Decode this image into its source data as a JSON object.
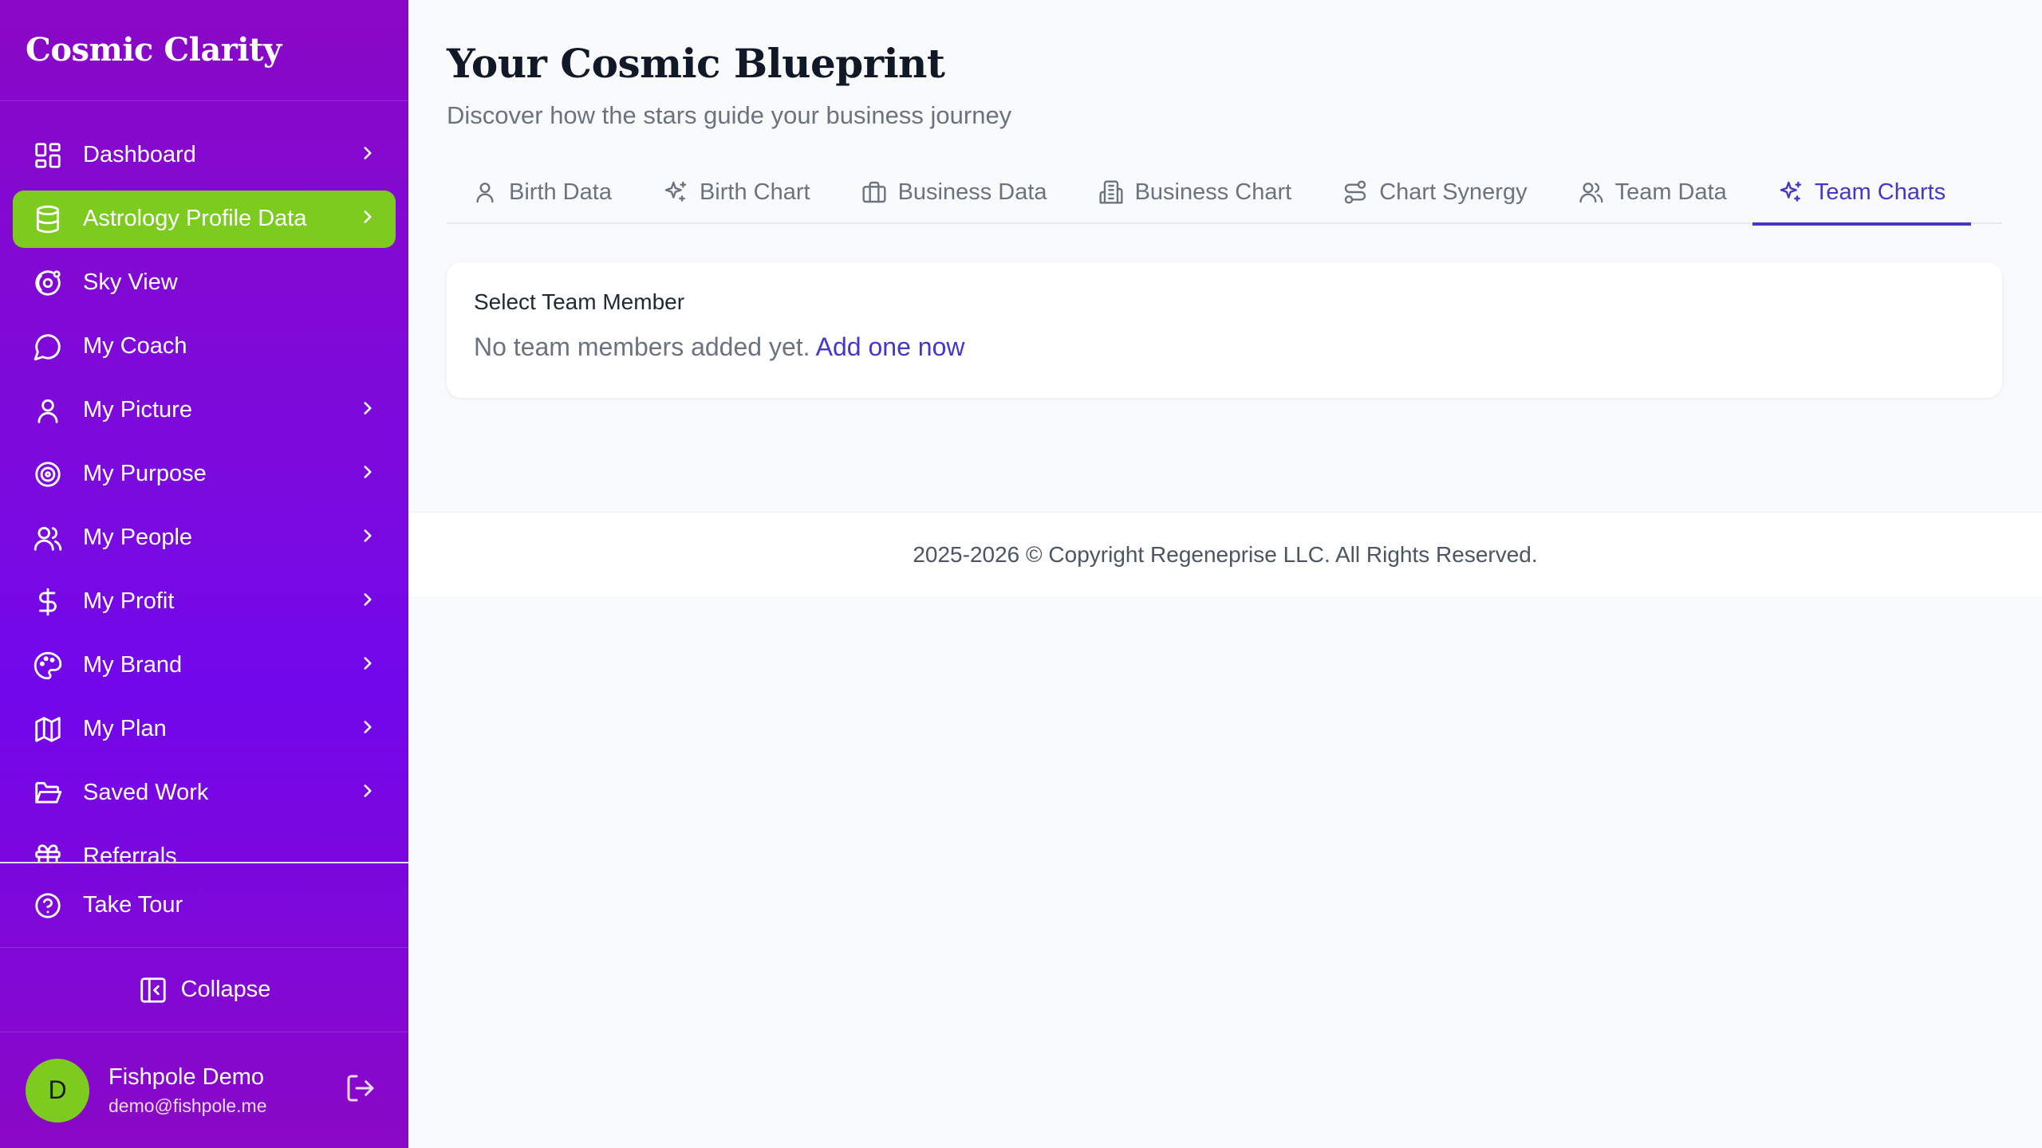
{
  "sidebar": {
    "brand": "Cosmic Clarity",
    "items": [
      {
        "label": "Dashboard",
        "icon": "dashboard-icon",
        "chevron": true,
        "active": false
      },
      {
        "label": "Astrology Profile Data",
        "icon": "database-icon",
        "chevron": true,
        "active": true
      },
      {
        "label": "Sky View",
        "icon": "orbit-icon",
        "chevron": false,
        "active": false
      },
      {
        "label": "My Coach",
        "icon": "chat-icon",
        "chevron": false,
        "active": false
      },
      {
        "label": "My Picture",
        "icon": "user-icon",
        "chevron": true,
        "active": false
      },
      {
        "label": "My Purpose",
        "icon": "target-icon",
        "chevron": true,
        "active": false
      },
      {
        "label": "My People",
        "icon": "users-icon",
        "chevron": true,
        "active": false
      },
      {
        "label": "My Profit",
        "icon": "dollar-icon",
        "chevron": true,
        "active": false
      },
      {
        "label": "My Brand",
        "icon": "palette-icon",
        "chevron": true,
        "active": false
      },
      {
        "label": "My Plan",
        "icon": "map-icon",
        "chevron": true,
        "active": false
      },
      {
        "label": "Saved Work",
        "icon": "folder-icon",
        "chevron": true,
        "active": false
      },
      {
        "label": "Referrals",
        "icon": "gift-icon",
        "chevron": false,
        "active": false
      }
    ],
    "tour_label": "Take Tour",
    "collapse_label": "Collapse",
    "user": {
      "initial": "D",
      "name": "Fishpole Demo",
      "email": "demo@fishpole.me"
    }
  },
  "main": {
    "title": "Your Cosmic Blueprint",
    "subtitle": "Discover how the stars guide your business journey",
    "tabs": [
      {
        "label": "Birth Data",
        "icon": "person-icon",
        "active": false
      },
      {
        "label": "Birth Chart",
        "icon": "sparkles-icon",
        "active": false
      },
      {
        "label": "Business Data",
        "icon": "briefcase-icon",
        "active": false
      },
      {
        "label": "Business Chart",
        "icon": "building-icon",
        "active": false
      },
      {
        "label": "Chart Synergy",
        "icon": "route-icon",
        "active": false
      },
      {
        "label": "Team Data",
        "icon": "team-icon",
        "active": false
      },
      {
        "label": "Team Charts",
        "icon": "sparkles-icon",
        "active": true
      }
    ],
    "card": {
      "label": "Select Team Member",
      "empty_text": "No team members added yet.",
      "add_link": "Add one now"
    },
    "footer": "2025-2026 © Copyright Regeneprise LLC. All Rights Reserved."
  },
  "colors": {
    "sidebar_top": "#8a08c6",
    "sidebar_mid": "#7207ec",
    "active_item": "#7ccb1e",
    "accent": "#4338ca"
  }
}
